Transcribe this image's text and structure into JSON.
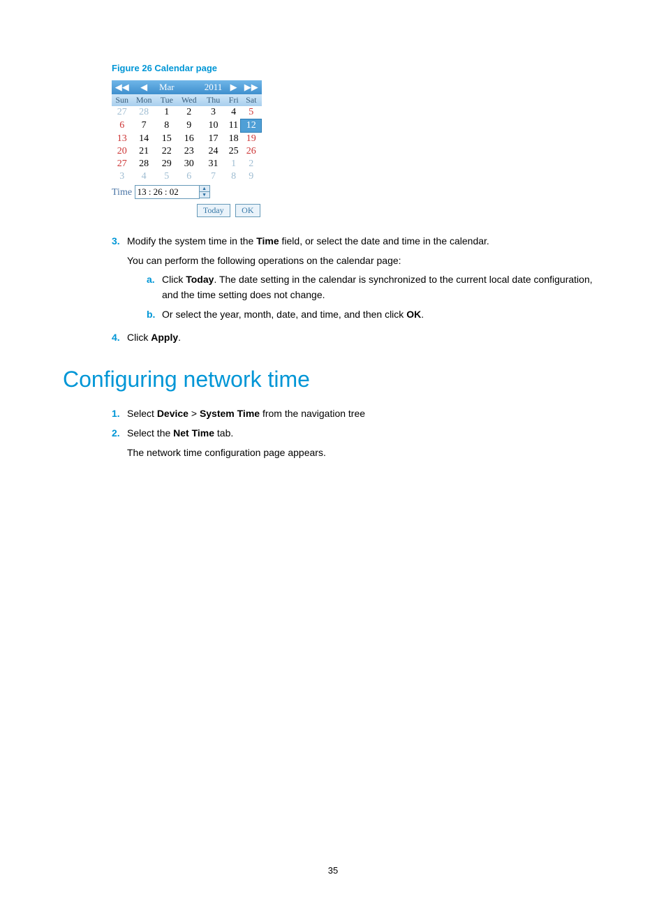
{
  "figure_caption": "Figure 26 Calendar page",
  "calendar": {
    "month": "Mar",
    "year": "2011",
    "dow": [
      "Sun",
      "Mon",
      "Tue",
      "Wed",
      "Thu",
      "Fri",
      "Sat"
    ],
    "rows": [
      [
        {
          "v": "27",
          "cls": "prev-month"
        },
        {
          "v": "28",
          "cls": "prev-month"
        },
        {
          "v": "1",
          "cls": ""
        },
        {
          "v": "2",
          "cls": ""
        },
        {
          "v": "3",
          "cls": ""
        },
        {
          "v": "4",
          "cls": ""
        },
        {
          "v": "5",
          "cls": "cell-red"
        }
      ],
      [
        {
          "v": "6",
          "cls": "cell-red"
        },
        {
          "v": "7",
          "cls": ""
        },
        {
          "v": "8",
          "cls": ""
        },
        {
          "v": "9",
          "cls": ""
        },
        {
          "v": "10",
          "cls": ""
        },
        {
          "v": "11",
          "cls": ""
        },
        {
          "v": "12",
          "cls": "cell-sel"
        }
      ],
      [
        {
          "v": "13",
          "cls": "cell-red"
        },
        {
          "v": "14",
          "cls": ""
        },
        {
          "v": "15",
          "cls": ""
        },
        {
          "v": "16",
          "cls": ""
        },
        {
          "v": "17",
          "cls": ""
        },
        {
          "v": "18",
          "cls": ""
        },
        {
          "v": "19",
          "cls": "cell-red"
        }
      ],
      [
        {
          "v": "20",
          "cls": "cell-red"
        },
        {
          "v": "21",
          "cls": ""
        },
        {
          "v": "22",
          "cls": ""
        },
        {
          "v": "23",
          "cls": ""
        },
        {
          "v": "24",
          "cls": ""
        },
        {
          "v": "25",
          "cls": ""
        },
        {
          "v": "26",
          "cls": "cell-red"
        }
      ],
      [
        {
          "v": "27",
          "cls": "cell-red"
        },
        {
          "v": "28",
          "cls": ""
        },
        {
          "v": "29",
          "cls": ""
        },
        {
          "v": "30",
          "cls": ""
        },
        {
          "v": "31",
          "cls": ""
        },
        {
          "v": "1",
          "cls": "next-month"
        },
        {
          "v": "2",
          "cls": "next-month"
        }
      ],
      [
        {
          "v": "3",
          "cls": "next-month"
        },
        {
          "v": "4",
          "cls": "next-month"
        },
        {
          "v": "5",
          "cls": "next-month"
        },
        {
          "v": "6",
          "cls": "next-month"
        },
        {
          "v": "7",
          "cls": "next-month"
        },
        {
          "v": "8",
          "cls": "next-month"
        },
        {
          "v": "9",
          "cls": "next-month"
        }
      ]
    ],
    "time_label": "Time",
    "time_value": "13 : 26 : 02",
    "today_btn": "Today",
    "ok_btn": "OK"
  },
  "steps": {
    "s3_num": "3.",
    "s3_a": "Modify the system time in the ",
    "s3_b": "Time",
    "s3_c": " field, or select the date and time in the calendar.",
    "s3_line2": "You can perform the following operations on the calendar page:",
    "s3a_num": "a.",
    "s3a_a": "Click ",
    "s3a_b": "Today",
    "s3a_c": ". The date setting in the calendar is synchronized to the current local date configuration, and the time setting does not change.",
    "s3b_num": "b.",
    "s3b_a": "Or select the year, month, date, and time, and then click ",
    "s3b_b": "OK",
    "s3b_c": ".",
    "s4_num": "4.",
    "s4_a": "Click ",
    "s4_b": "Apply",
    "s4_c": "."
  },
  "section_heading": "Configuring network time",
  "steps2": {
    "s1_num": "1.",
    "s1_a": "Select ",
    "s1_b": "Device",
    "s1_c": " > ",
    "s1_d": "System Time",
    "s1_e": " from the navigation tree",
    "s2_num": "2.",
    "s2_a": "Select the ",
    "s2_b": "Net Time",
    "s2_c": " tab.",
    "s2_line2": "The network time configuration page appears."
  },
  "page_number": "35"
}
